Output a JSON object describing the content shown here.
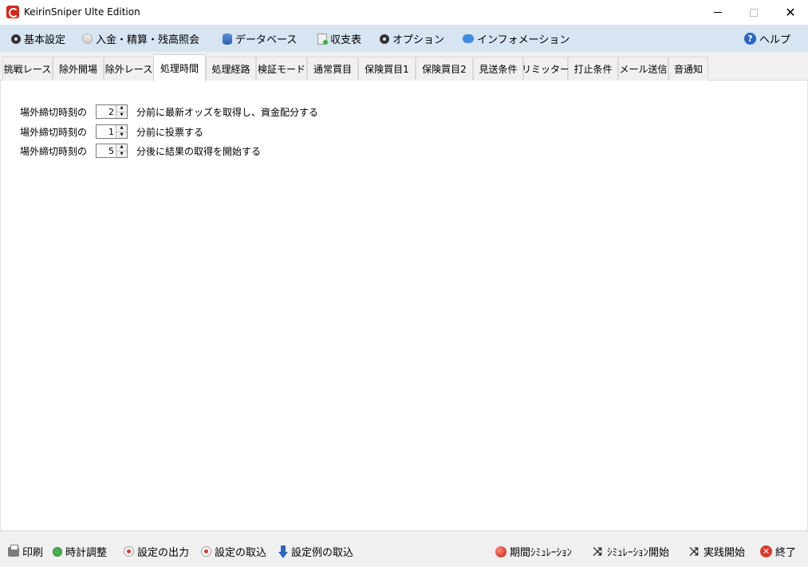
{
  "window": {
    "title": "KeirinSniper Ulte Edition",
    "icon": "app-logo-icon",
    "controls": {
      "minimize": "minimize-icon",
      "maximize": "maximize-icon",
      "close": "close-icon",
      "close_glyph": "✕"
    }
  },
  "menu": {
    "items": [
      {
        "label": "基本設定",
        "icon": "gear-icon"
      },
      {
        "label": "入金・精算・残高照会",
        "icon": "coin-icon"
      },
      {
        "label": "データベース",
        "icon": "database-icon"
      },
      {
        "label": "収支表",
        "icon": "ledger-icon"
      },
      {
        "label": "オプション",
        "icon": "gear-icon"
      },
      {
        "label": "インフォメーション",
        "icon": "chat-bubble-icon"
      }
    ],
    "help": {
      "label": "ヘルプ",
      "icon": "help-icon",
      "glyph": "?"
    }
  },
  "tabs": {
    "items": [
      "挑戦レース",
      "除外開場",
      "除外レース",
      "処理時間",
      "処理経路",
      "検証モード",
      "通常買目",
      "保険買目1",
      "保険買目2",
      "見送条件",
      "リミッター",
      "打止条件",
      "メール送信",
      "音通知"
    ],
    "active": "処理時間"
  },
  "settings": {
    "rows": [
      {
        "label": "場外締切時刻の",
        "value": "2",
        "suffix": "分前に最新オッズを取得し、資金配分する"
      },
      {
        "label": "場外締切時刻の",
        "value": "1",
        "suffix": "分前に投票する"
      },
      {
        "label": "場外締切時刻の",
        "value": "5",
        "suffix": "分後に結果の取得を開始する"
      }
    ],
    "spin_up": "▲",
    "spin_down": "▼"
  },
  "bottom": {
    "left": [
      {
        "label": "印刷",
        "icon": "printer-icon"
      },
      {
        "label": "時計調整",
        "icon": "clock-icon"
      },
      {
        "label": "設定の出力",
        "icon": "record-icon"
      },
      {
        "label": "設定の取込",
        "icon": "record-icon"
      },
      {
        "label": "設定例の取込",
        "icon": "arrow-down-icon"
      }
    ],
    "right": [
      {
        "label": "期間ｼﾐｭﾚｰｼｮﾝ",
        "icon": "red-ball-icon"
      },
      {
        "label": "ｼﾐｭﾚｰｼｮﾝ開始",
        "icon": "shuffle-icon"
      },
      {
        "label": "実践開始",
        "icon": "shuffle-icon"
      },
      {
        "label": "終了",
        "icon": "exit-icon"
      }
    ],
    "shuffle_glyph": "⤨",
    "exit_glyph": "✕"
  }
}
